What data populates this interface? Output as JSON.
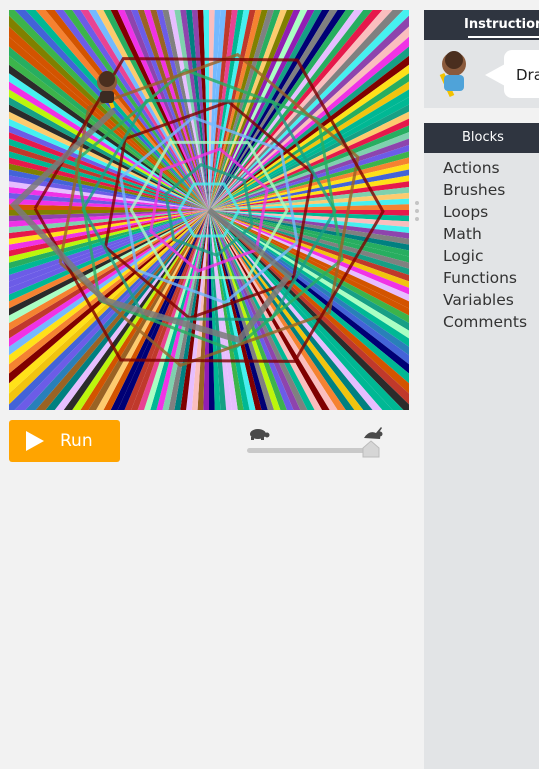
{
  "run_label": "Run",
  "instructions": {
    "title": "Instructions",
    "text": "Draw"
  },
  "blocks": {
    "title": "Blocks",
    "categories": [
      "Actions",
      "Brushes",
      "Loops",
      "Math",
      "Logic",
      "Functions",
      "Variables",
      "Comments"
    ]
  },
  "speed_level": 1.0,
  "colors": {
    "run_button": "#ffa400",
    "panel_header": "#2f3540",
    "panel_body": "#e2e4e6",
    "page_background": "#f2f2f2"
  },
  "icons": [
    "play-icon",
    "turtle-icon",
    "rabbit-icon",
    "artist-character-icon",
    "drag-handle-icon"
  ]
}
